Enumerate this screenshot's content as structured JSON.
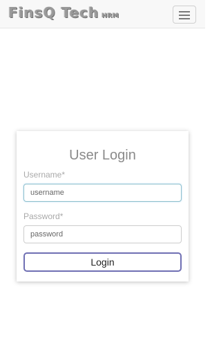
{
  "navbar": {
    "brand_main": "FinsQ Tech",
    "brand_sub": "HRM",
    "toggle_icon": "hamburger-icon"
  },
  "login": {
    "title": "User Login",
    "username_label": "Username*",
    "username_placeholder": "username",
    "password_label": "Password*",
    "password_placeholder": "password",
    "button_label": "Login"
  },
  "colors": {
    "navbar_bg": "#f8f8f8",
    "button_border": "#6f6fb3",
    "focus_border": "#8fc0cc"
  }
}
